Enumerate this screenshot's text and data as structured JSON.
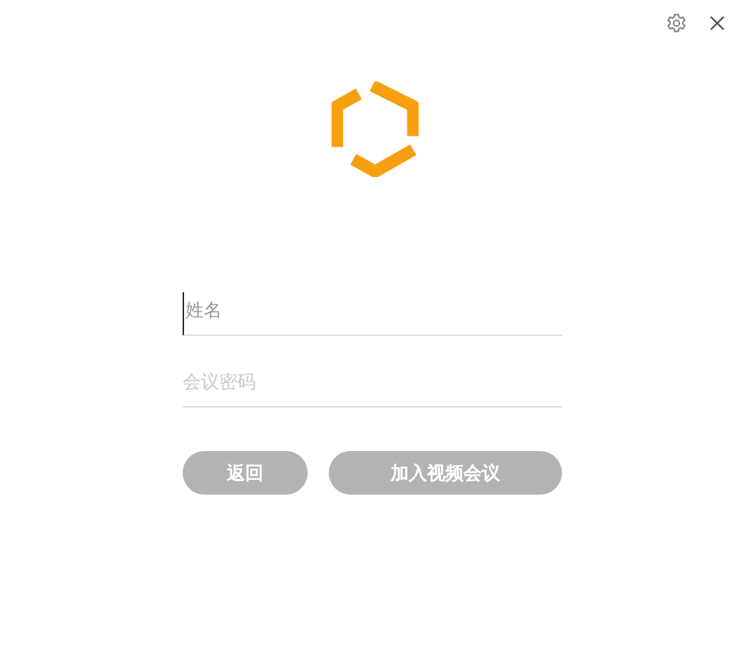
{
  "fields": [
    {
      "placeholder": "姓名",
      "focused": true
    },
    {
      "placeholder": "会议密码",
      "focused": false
    }
  ],
  "buttons": [
    {
      "label": "返回",
      "kind": "back",
      "disabled": true
    },
    {
      "label": "加入视频会议",
      "kind": "join",
      "disabled": true
    }
  ]
}
